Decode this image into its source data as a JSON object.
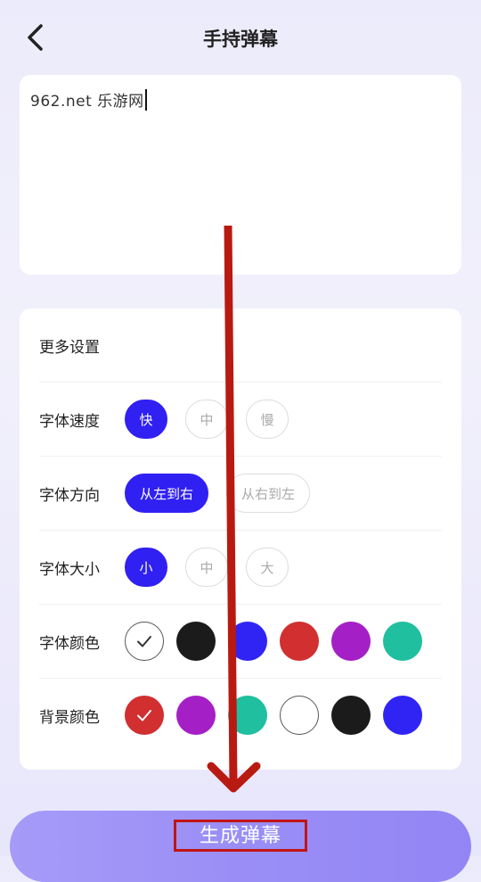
{
  "header": {
    "title": "手持弹幕",
    "back_icon": "chevron-left-icon"
  },
  "text_input": {
    "value": "962.net 乐游网"
  },
  "settings": {
    "heading": "更多设置",
    "speed": {
      "label": "字体速度",
      "options": [
        "快",
        "中",
        "慢"
      ],
      "selected": "快"
    },
    "direction": {
      "label": "字体方向",
      "options": [
        "从左到右",
        "从右到左"
      ],
      "selected": "从左到右"
    },
    "size": {
      "label": "字体大小",
      "options": [
        "小",
        "中",
        "大"
      ],
      "selected": "小"
    },
    "font_color": {
      "label": "字体颜色",
      "colors": [
        "#ffffff",
        "#1b1b1b",
        "#3024f5",
        "#d12f30",
        "#a51fc6",
        "#1fbf9f"
      ],
      "selected_index": 0
    },
    "background_color": {
      "label": "背景颜色",
      "colors": [
        "#d12f30",
        "#a51fc6",
        "#1fbf9f",
        "#ffffff",
        "#1b1b1b",
        "#3024f5"
      ],
      "selected_index": 0
    }
  },
  "generate_button": {
    "label": "生成弹幕"
  },
  "annotation": {
    "arrow_color": "#b81a12",
    "highlight_color": "#c01515"
  }
}
